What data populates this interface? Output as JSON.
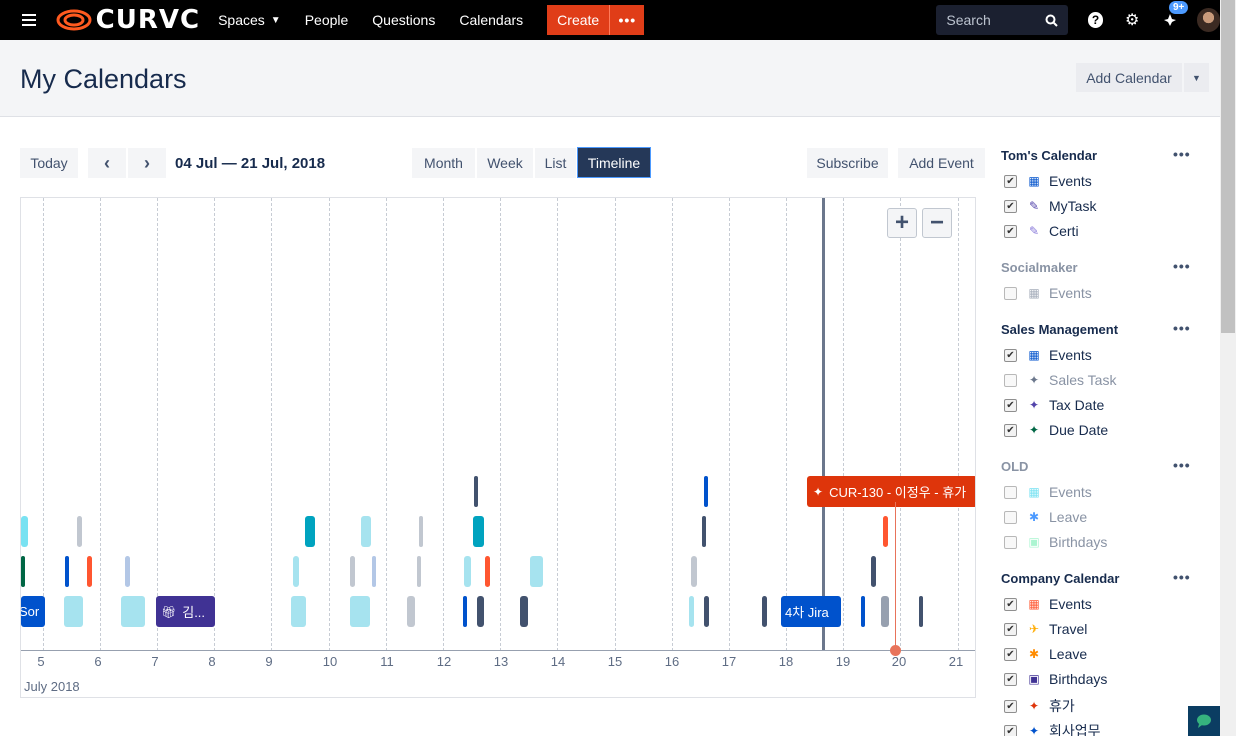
{
  "nav": {
    "logo": "CURVC",
    "links": [
      "Spaces",
      "People",
      "Questions",
      "Calendars"
    ],
    "create": "Create",
    "search_placeholder": "Search",
    "badge": "9+"
  },
  "header": {
    "title": "My Calendars",
    "add_calendar": "Add Calendar"
  },
  "toolbar": {
    "today": "Today",
    "prev": "‹",
    "next": "›",
    "date_range": "04 Jul — 21 Jul, 2018",
    "views": [
      "Month",
      "Week",
      "List",
      "Timeline"
    ],
    "active_view": "Timeline",
    "subscribe": "Subscribe",
    "add_event": "Add Event"
  },
  "timeline": {
    "days": [
      "5",
      "6",
      "7",
      "8",
      "9",
      "10",
      "11",
      "12",
      "13",
      "14",
      "15",
      "16",
      "17",
      "18",
      "19",
      "20",
      "21"
    ],
    "month": "July 2018",
    "events": {
      "ev1": "Sor",
      "ev2": "김...",
      "ev3": "4차 Jira",
      "ev4": "CUR-130 - 이정우 - 휴가"
    }
  },
  "sidebar": {
    "groups": [
      {
        "title": "Tom's Calendar",
        "items": [
          {
            "label": "Events",
            "checked": true,
            "icon": "calendar-icon",
            "color": "#0052cc"
          },
          {
            "label": "MyTask",
            "checked": true,
            "icon": "pencil-icon",
            "color": "#5243aa"
          },
          {
            "label": "Certi",
            "checked": true,
            "icon": "pencil-icon",
            "color": "#8777d9"
          }
        ]
      },
      {
        "title": "Socialmaker",
        "items": [
          {
            "label": "Events",
            "checked": false,
            "icon": "calendar-icon",
            "color": "#a5adba"
          }
        ]
      },
      {
        "title": "Sales Management",
        "items": [
          {
            "label": "Events",
            "checked": true,
            "icon": "calendar-icon",
            "color": "#0052cc"
          },
          {
            "label": "Sales Task",
            "checked": false,
            "icon": "jira-icon",
            "color": "#6b778c"
          },
          {
            "label": "Tax Date",
            "checked": true,
            "icon": "jira-icon",
            "color": "#5243aa"
          },
          {
            "label": "Due Date",
            "checked": true,
            "icon": "jira-icon",
            "color": "#006644"
          }
        ]
      },
      {
        "title": "OLD",
        "items": [
          {
            "label": "Events",
            "checked": false,
            "icon": "calendar-icon",
            "color": "#79e2f2"
          },
          {
            "label": "Leave",
            "checked": false,
            "icon": "palm-tree-icon",
            "color": "#4c9aff"
          },
          {
            "label": "Birthdays",
            "checked": false,
            "icon": "gift-icon",
            "color": "#abf5d1"
          }
        ]
      },
      {
        "title": "Company Calendar",
        "items": [
          {
            "label": "Events",
            "checked": true,
            "icon": "calendar-icon",
            "color": "#ff5630"
          },
          {
            "label": "Travel",
            "checked": true,
            "icon": "plane-icon",
            "color": "#ffab00"
          },
          {
            "label": "Leave",
            "checked": true,
            "icon": "palm-tree-icon",
            "color": "#ff8b00"
          },
          {
            "label": "Birthdays",
            "checked": true,
            "icon": "gift-icon",
            "color": "#403294"
          },
          {
            "label": "휴가",
            "checked": true,
            "icon": "jira-icon",
            "color": "#de350b"
          },
          {
            "label": "회사업무",
            "checked": true,
            "icon": "jira-icon",
            "color": "#0052cc"
          }
        ]
      }
    ]
  }
}
